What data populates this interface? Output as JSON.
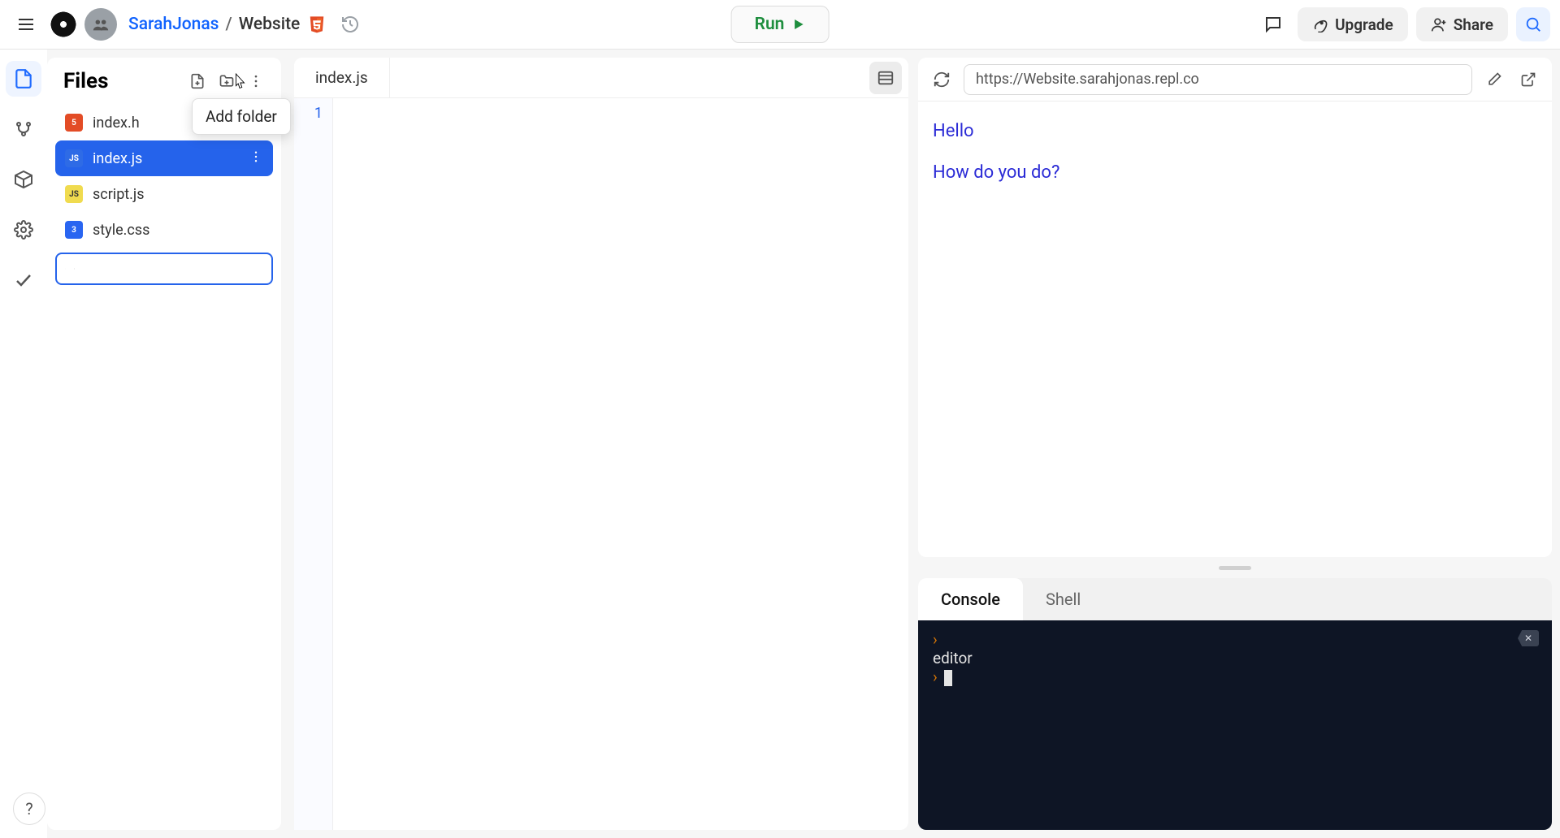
{
  "header": {
    "user": "SarahJonas",
    "separator": "/",
    "project": "Website",
    "run_label": "Run",
    "upgrade_label": "Upgrade",
    "share_label": "Share"
  },
  "files_panel": {
    "title": "Files",
    "add_folder_tooltip": "Add folder",
    "files": [
      {
        "name": "index.html",
        "type": "html",
        "display": "index.h"
      },
      {
        "name": "index.js",
        "type": "js",
        "display": "index.js",
        "selected": true
      },
      {
        "name": "script.js",
        "type": "js",
        "display": "script.js"
      },
      {
        "name": "style.css",
        "type": "css",
        "display": "style.css"
      }
    ],
    "new_folder_input_value": ""
  },
  "editor": {
    "tab_label": "index.js",
    "line_numbers": [
      "1"
    ],
    "content": ""
  },
  "preview": {
    "url": "https://Website.sarahjonas.repl.co",
    "lines": [
      "Hello",
      "How do you do?"
    ]
  },
  "console": {
    "tabs": [
      {
        "label": "Console",
        "active": true
      },
      {
        "label": "Shell",
        "active": false
      }
    ],
    "output_line": "editor"
  }
}
